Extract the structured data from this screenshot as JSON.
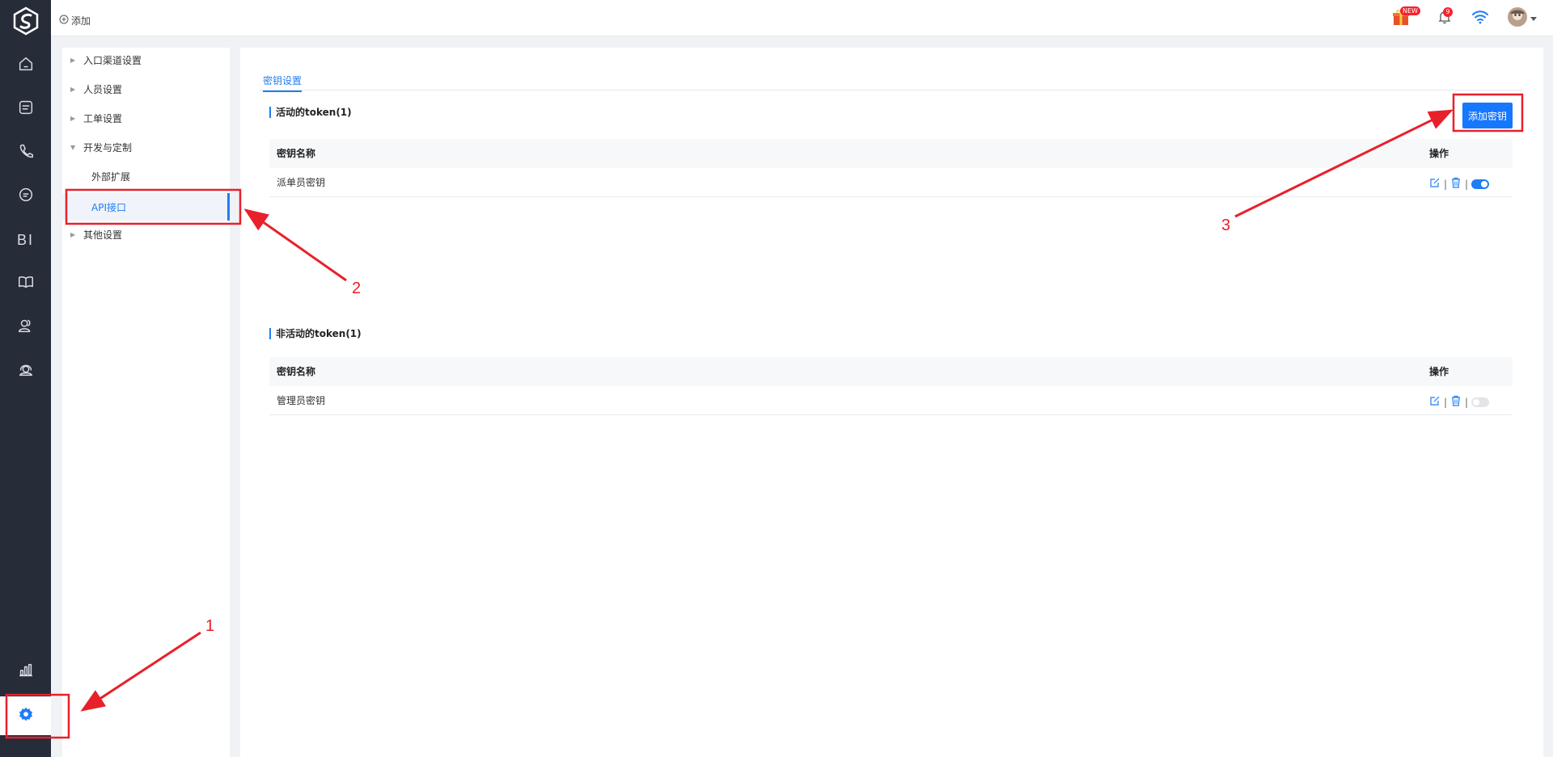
{
  "topbar": {
    "add_label": "添加",
    "notification_count": "9",
    "gift_badge": "NEW"
  },
  "rail": {
    "items": [
      {
        "icon": "home-icon"
      },
      {
        "icon": "list-icon"
      },
      {
        "icon": "phone-icon"
      },
      {
        "icon": "chat-icon"
      },
      {
        "icon": "bi-icon",
        "label": "BI"
      },
      {
        "icon": "book-icon"
      },
      {
        "icon": "users-icon"
      },
      {
        "icon": "headset-icon"
      },
      {
        "icon": "stats-icon"
      },
      {
        "icon": "gear-icon"
      }
    ]
  },
  "sidebar": {
    "items": [
      {
        "label": "入口渠道设置"
      },
      {
        "label": "人员设置"
      },
      {
        "label": "工单设置"
      },
      {
        "label": "开发与定制"
      },
      {
        "label": "外部扩展"
      },
      {
        "label": "API接口"
      },
      {
        "label": "其他设置"
      }
    ]
  },
  "main": {
    "tab_label": "密钥设置",
    "add_key_label": "添加密钥",
    "active": {
      "title": "活动的token(1)",
      "col_name": "密钥名称",
      "col_ops": "操作",
      "rows": [
        {
          "name": "派单员密钥",
          "enabled": true
        }
      ]
    },
    "inactive": {
      "title": "非活动的token(1)",
      "col_name": "密钥名称",
      "col_ops": "操作",
      "rows": [
        {
          "name": "管理员密钥",
          "enabled": false
        }
      ]
    },
    "op_separator": "|"
  },
  "annotations": {
    "step1": "1",
    "step2": "2",
    "step3": "3"
  },
  "colors": {
    "accent": "#1f7df5",
    "rail_bg": "#262c38",
    "annotation_red": "#e8202a"
  }
}
